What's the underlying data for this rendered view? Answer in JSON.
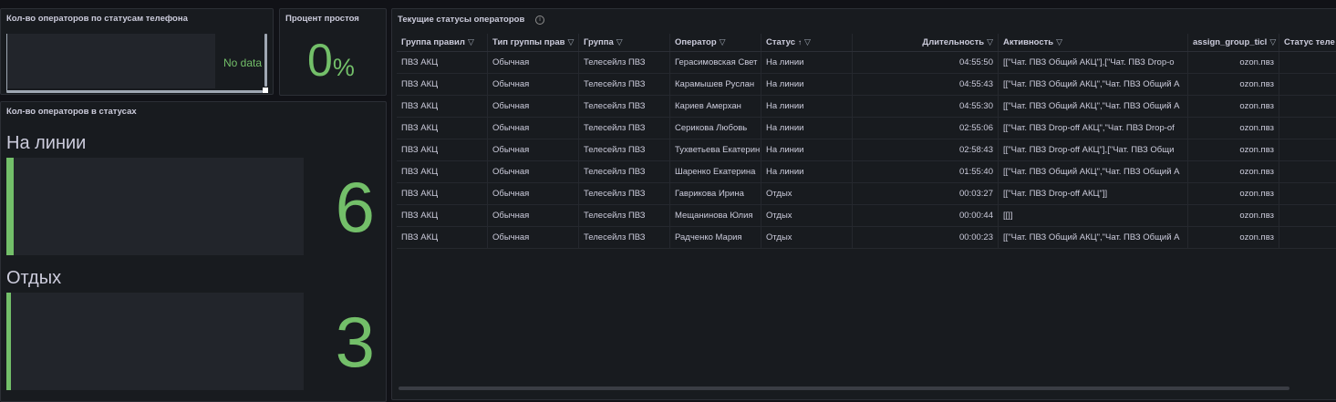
{
  "panels": {
    "phone_status": {
      "title": "Кол-во операторов по статусам телефона",
      "no_data": "No data"
    },
    "idle_percent": {
      "title": "Процент простоя",
      "value": "0",
      "unit": "%"
    },
    "status_counts": {
      "title": "Кол-во операторов в статусах",
      "items": [
        {
          "label": "На линии",
          "value": "6"
        },
        {
          "label": "Отдых",
          "value": "3"
        }
      ]
    },
    "current_statuses": {
      "title": "Текущие статусы операторов",
      "info_icon": "info-icon",
      "columns": [
        "Группа правил",
        "Тип группы прав",
        "Группа",
        "Оператор",
        "Статус",
        "Длительность",
        "Активность",
        "assign_group_ticl",
        "Статус теле"
      ],
      "rows": [
        [
          "ПВЗ АКЦ",
          "Обычная",
          "Телесейлз ПВЗ",
          "Герасимовская Свет",
          "На линии",
          "04:55:50",
          "[[\"Чат. ПВЗ Общий АКЦ\"],[\"Чат. ПВЗ Drop-o",
          "ozon.пвз",
          ""
        ],
        [
          "ПВЗ АКЦ",
          "Обычная",
          "Телесейлз ПВЗ",
          "Карамышев Руслан",
          "На линии",
          "04:55:43",
          "[[\"Чат. ПВЗ Общий АКЦ\",\"Чат. ПВЗ Общий А",
          "ozon.пвз",
          ""
        ],
        [
          "ПВЗ АКЦ",
          "Обычная",
          "Телесейлз ПВЗ",
          "Кариев Амерхан",
          "На линии",
          "04:55:30",
          "[[\"Чат. ПВЗ Общий АКЦ\",\"Чат. ПВЗ Общий А",
          "ozon.пвз",
          ""
        ],
        [
          "ПВЗ АКЦ",
          "Обычная",
          "Телесейлз ПВЗ",
          "Серикова Любовь",
          "На линии",
          "02:55:06",
          "[[\"Чат. ПВЗ Drop-off АКЦ\",\"Чат. ПВЗ Drop-of",
          "ozon.пвз",
          ""
        ],
        [
          "ПВЗ АКЦ",
          "Обычная",
          "Телесейлз ПВЗ",
          "Тухветьева Екатерин",
          "На линии",
          "02:58:43",
          "[[\"Чат. ПВЗ Drop-off АКЦ\"],[\"Чат. ПВЗ Общи",
          "ozon.пвз",
          ""
        ],
        [
          "ПВЗ АКЦ",
          "Обычная",
          "Телесейлз ПВЗ",
          "Шаренко Екатерина",
          "На линии",
          "01:55:40",
          "[[\"Чат. ПВЗ Общий АКЦ\",\"Чат. ПВЗ Общий А",
          "ozon.пвз",
          ""
        ],
        [
          "ПВЗ АКЦ",
          "Обычная",
          "Телесейлз ПВЗ",
          "Гаврикова Ирина",
          "Отдых",
          "00:03:27",
          "[[\"Чат. ПВЗ Drop-off АКЦ\"]]",
          "ozon.пвз",
          ""
        ],
        [
          "ПВЗ АКЦ",
          "Обычная",
          "Телесейлз ПВЗ",
          "Мещанинова Юлия",
          "Отдых",
          "00:00:44",
          "[[]]",
          "ozon.пвз",
          ""
        ],
        [
          "ПВЗ АКЦ",
          "Обычная",
          "Телесейлз ПВЗ",
          "Радченко Мария",
          "Отдых",
          "00:00:23",
          "[[\"Чат. ПВЗ Общий АКЦ\",\"Чат. ПВЗ Общий А",
          "ozon.пвз",
          ""
        ]
      ]
    }
  },
  "colors": {
    "accent": "#73bf69",
    "panel_bg": "#181b1f",
    "page_bg": "#111217"
  }
}
